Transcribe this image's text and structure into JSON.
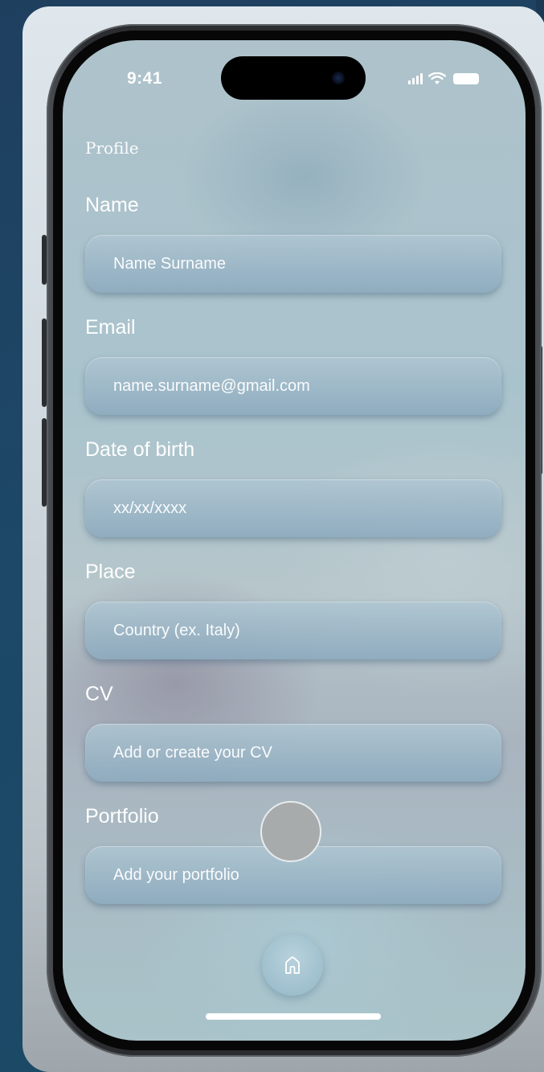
{
  "status_bar": {
    "time": "9:41",
    "icons": [
      "signal-icon",
      "wifi-icon",
      "battery-icon"
    ]
  },
  "page": {
    "title": "Profile"
  },
  "form": {
    "fields": [
      {
        "label": "Name",
        "placeholder": "Name Surname"
      },
      {
        "label": "Email",
        "placeholder": "name.surname@gmail.com"
      },
      {
        "label": "Date of birth",
        "placeholder": "xx/xx/xxxx"
      },
      {
        "label": "Place",
        "placeholder": "Country (ex. Italy)"
      },
      {
        "label": "CV",
        "placeholder": "Add or create your CV"
      },
      {
        "label": "Portfolio",
        "placeholder": "Add your portfolio"
      }
    ]
  },
  "nav": {
    "home_icon": "home-icon"
  },
  "colors": {
    "text": "#ffffff",
    "field_top": "#afc6d2",
    "field_bottom": "#8caabe",
    "background": "#1d4868"
  }
}
